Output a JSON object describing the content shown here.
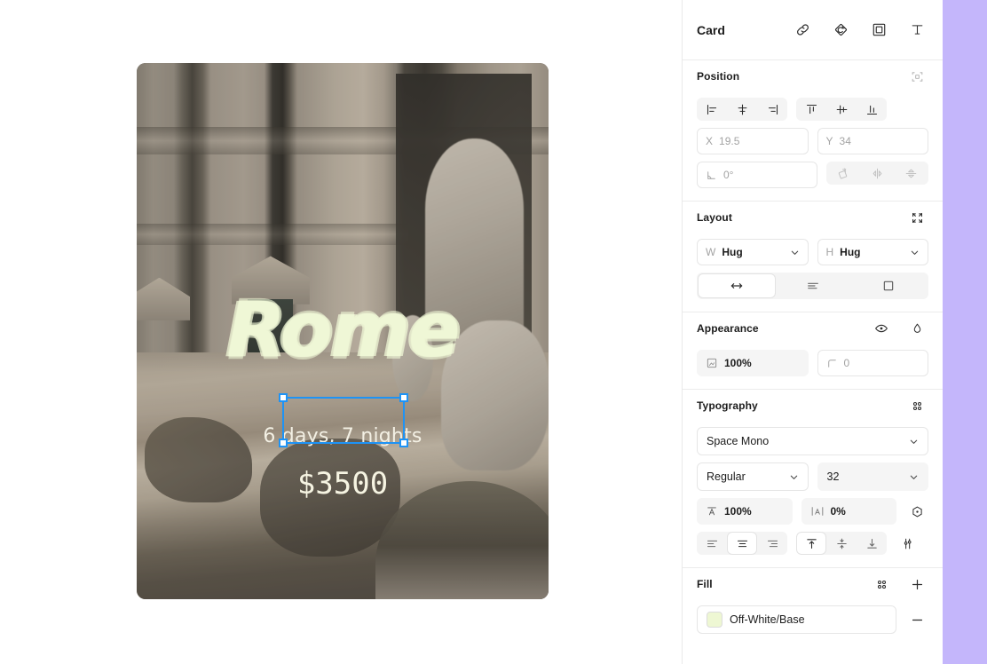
{
  "canvas": {
    "card": {
      "title": "Rome",
      "subtitle": "6 days, 7 nights",
      "price": "$3500",
      "title_color": "#eff7d6",
      "subtitle_color": "#f3f0e4",
      "price_color": "#f6f4e2"
    },
    "selection": {
      "accent_color": "#1e93f5",
      "handle_fill": "#ffffff"
    }
  },
  "panel": {
    "header": {
      "title": "Card",
      "icons": [
        "link-icon",
        "detach-instance-icon",
        "frame-icon",
        "text-icon"
      ]
    },
    "position": {
      "title": "Position",
      "absolute_icon": "absolute-position-icon",
      "align": {
        "horizontal": [
          "align-left-icon",
          "align-horizontal-center-icon",
          "align-right-icon"
        ],
        "vertical": [
          "align-top-icon",
          "align-vertical-center-icon",
          "align-bottom-icon"
        ]
      },
      "x": {
        "label": "X",
        "value": "19.5"
      },
      "y": {
        "label": "Y",
        "value": "34"
      },
      "rotation": {
        "label": "rotation-icon",
        "value": "0°"
      },
      "transforms": [
        "rotate-90-icon",
        "flip-horizontal-icon",
        "flip-vertical-icon"
      ]
    },
    "layout": {
      "title": "Layout",
      "collapse_icon": "collapse-icon",
      "width": {
        "label": "W",
        "value": "Hug"
      },
      "height": {
        "label": "H",
        "value": "Hug"
      },
      "modes": [
        "resize-horizontal-icon",
        "text-wrap-icon",
        "clip-content-icon"
      ],
      "selected_mode": 0
    },
    "appearance": {
      "title": "Appearance",
      "visibility_icon": "eye-icon",
      "blend_icon": "blend-mode-icon",
      "opacity": {
        "icon": "opacity-icon",
        "value": "100%"
      },
      "corner_radius": {
        "icon": "corner-radius-icon",
        "value": "0"
      }
    },
    "typography": {
      "title": "Typography",
      "styles_icon": "text-styles-icon",
      "font_family": "Space Mono",
      "font_weight": "Regular",
      "font_size": "32",
      "line_height": {
        "icon": "line-height-icon",
        "value": "100%"
      },
      "letter_spacing": {
        "icon": "letter-spacing-icon",
        "value": "0%"
      },
      "type_detail_icon": "type-detail-icon",
      "align_horizontal": [
        "text-align-left-icon",
        "text-align-center-icon",
        "text-align-right-icon"
      ],
      "align_horizontal_selected": 1,
      "align_vertical": [
        "text-align-top-icon",
        "text-align-middle-icon",
        "text-align-bottom-icon"
      ],
      "align_vertical_selected": 0,
      "settings_icon": "type-settings-icon"
    },
    "fill": {
      "title": "Fill",
      "styles_icon": "fill-styles-icon",
      "add_icon": "add-icon",
      "items": [
        {
          "name": "Off-White/Base",
          "color": "#eef7d3",
          "remove_icon": "remove-icon"
        }
      ]
    }
  }
}
